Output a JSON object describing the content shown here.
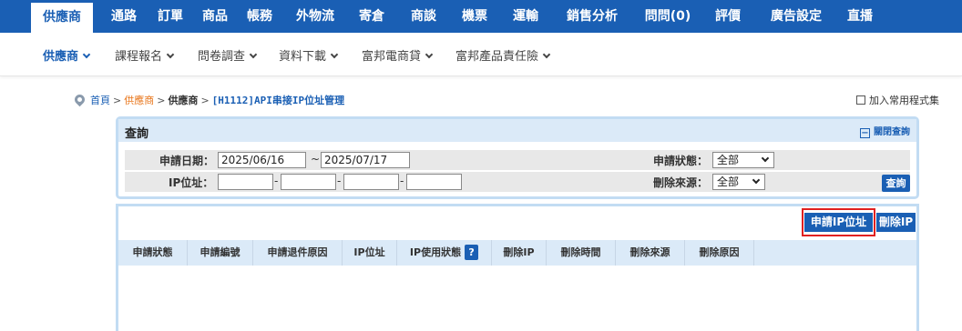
{
  "topnav": {
    "items": [
      "供應商",
      "通路",
      "訂單",
      "商品",
      "帳務",
      "外物流",
      "寄倉",
      "商談",
      "機票",
      "運輸",
      "銷售分析",
      "問問(0)",
      "評價",
      "廣告設定",
      "直播"
    ]
  },
  "subnav": {
    "items": [
      "供應商",
      "課程報名",
      "問卷調查",
      "資料下載",
      "富邦電商貸",
      "富邦產品責任險"
    ]
  },
  "breadcrumb": {
    "home": "首頁",
    "sep": ">",
    "supplier_link": "供應商",
    "supplier": "供應商",
    "page": "[H1112]API串接IP位址管理"
  },
  "favorite": {
    "label": "加入常用程式集"
  },
  "query": {
    "title": "查詢",
    "close_label": "關閉查詢",
    "date_label": "申請日期：",
    "date_from": "2025/06/16",
    "date_sep": "~",
    "date_to": "2025/07/17",
    "status_label": "申請狀態：",
    "status_value": "全部",
    "ip_label": "IP位址：",
    "ip_dash": "-",
    "source_label": "刪除來源：",
    "source_value": "全部",
    "search_button": "查詢"
  },
  "actions": {
    "apply_ip": "申請IP位址",
    "delete_ip": "刪除IP"
  },
  "table": {
    "columns": [
      "申請狀態",
      "申請編號",
      "申請退件原因",
      "IP位址",
      "IP使用狀態",
      "刪除IP",
      "刪除時間",
      "刪除來源",
      "刪除原因"
    ],
    "help_icon_label": "?"
  },
  "colors": {
    "brand_blue": "#1a5fb4",
    "highlight_red": "#e02020",
    "accent_orange": "#e8751a"
  }
}
